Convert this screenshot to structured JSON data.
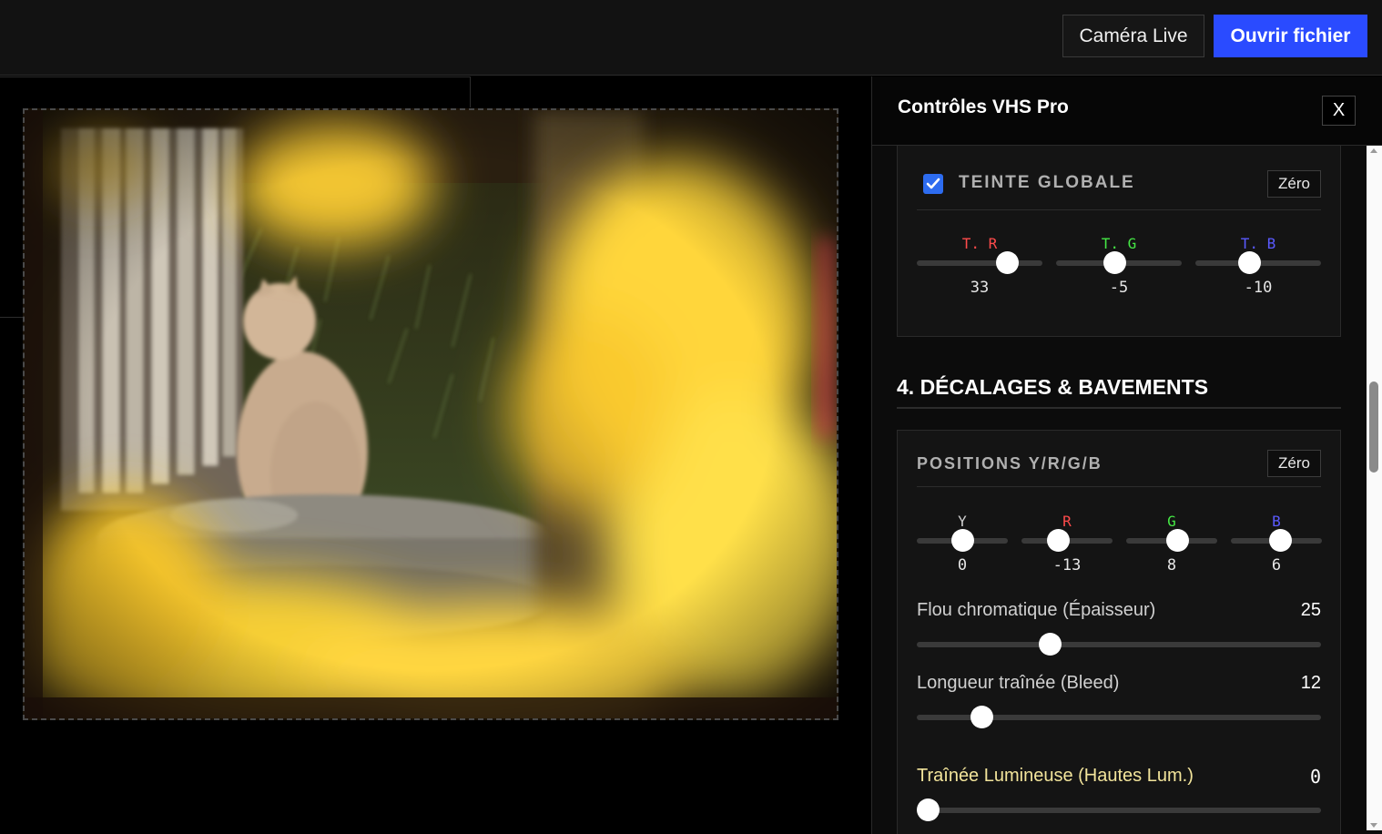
{
  "topbar": {
    "live_label": "Caméra Live",
    "open_label": "Ouvrir fichier"
  },
  "panel": {
    "title": "Contrôles VHS Pro",
    "close_label": "X"
  },
  "global_tint": {
    "enabled": true,
    "title": "TEINTE GLOBALE",
    "reset_label": "Zéro",
    "sliders": [
      {
        "label": "T. R",
        "value": "33",
        "color": "#ff4b4b",
        "level": 0.77
      },
      {
        "label": "T. G",
        "value": "-5",
        "color": "#45e845",
        "level": 0.46
      },
      {
        "label": "T. B",
        "value": "-10",
        "color": "#5a5aff",
        "level": 0.42
      }
    ]
  },
  "section4": {
    "title": "4. DÉCALAGES & BAVEMENTS"
  },
  "positions": {
    "title": "POSITIONS Y/R/G/B",
    "reset_label": "Zéro",
    "sliders": [
      {
        "label": "Y",
        "value": "0",
        "color": "#d0d0d0",
        "level": 0.5
      },
      {
        "label": "R",
        "value": "-13",
        "color": "#ff4b4b",
        "level": 0.37
      },
      {
        "label": "G",
        "value": "8",
        "color": "#45e845",
        "level": 0.58
      },
      {
        "label": "B",
        "value": "6",
        "color": "#5a5aff",
        "level": 0.56
      }
    ]
  },
  "chroma_blur": {
    "label": "Flou chromatique (Épaisseur)",
    "value": "25",
    "level": 0.32
  },
  "bleed_length": {
    "label": "Longueur traînée (Bleed)",
    "value": "12",
    "level": 0.14
  },
  "light_trail": {
    "label": "Traînée Lumineuse (Hautes Lum.)",
    "value": "0",
    "color": "#f2e49b",
    "level": 0.0
  }
}
